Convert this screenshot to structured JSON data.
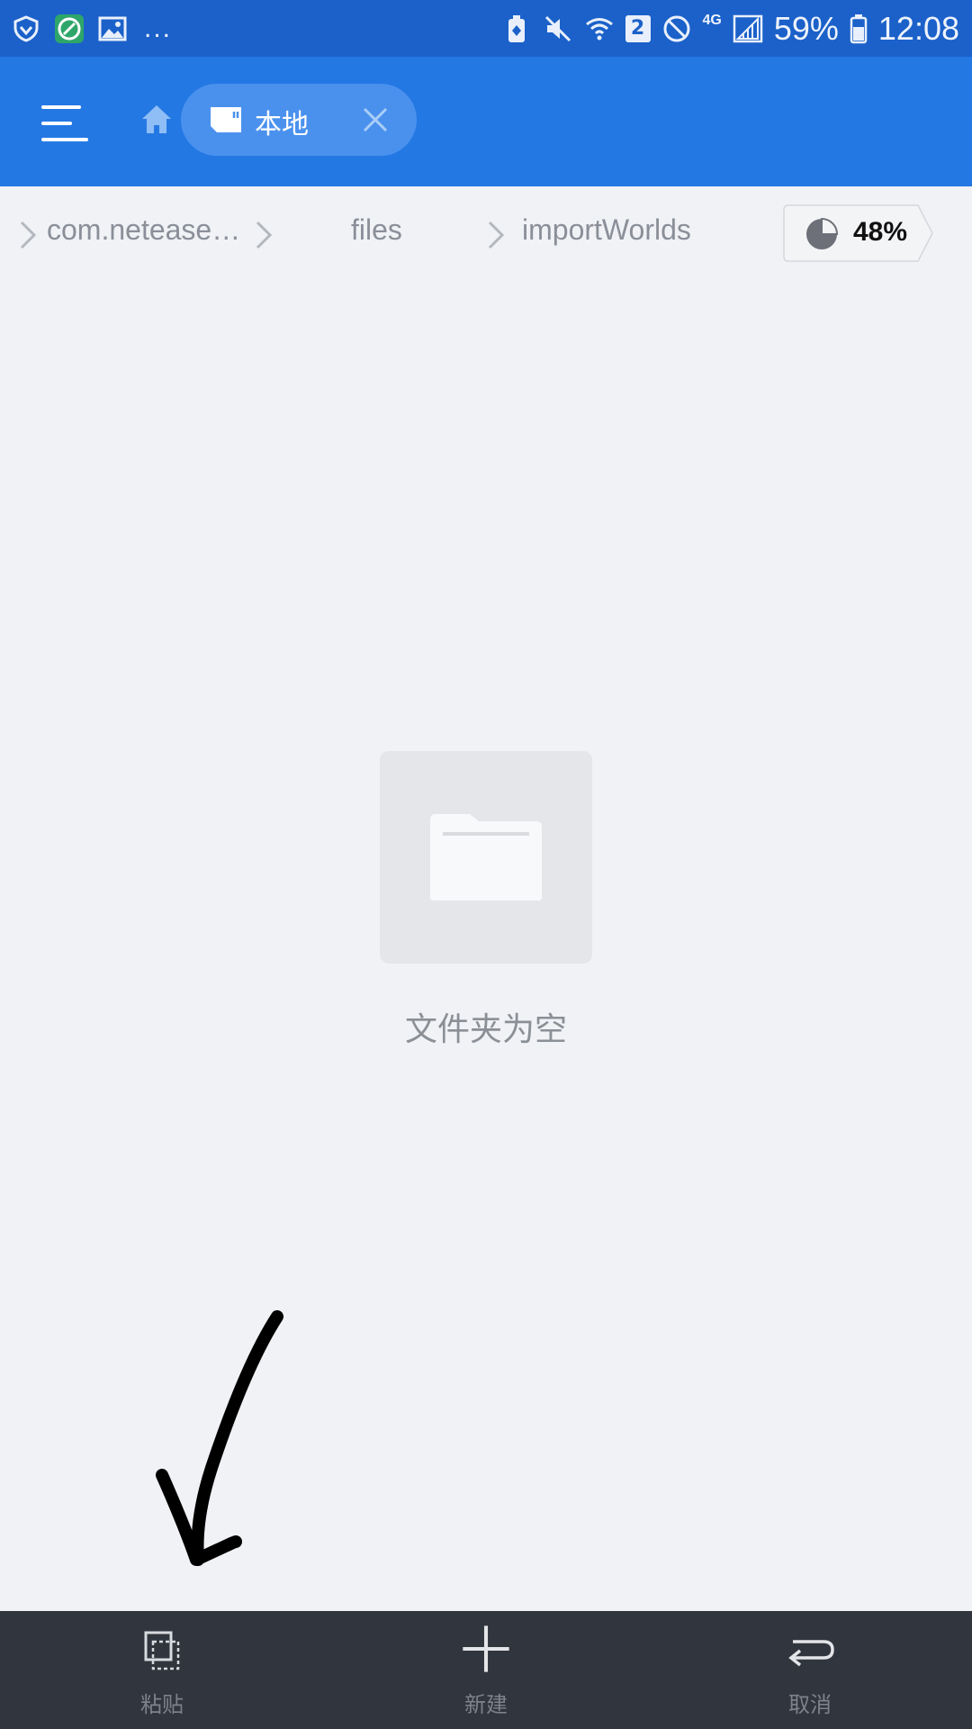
{
  "status_bar": {
    "battery_percent": "59%",
    "time": "12:08",
    "sim_slot": "2",
    "network_type": "4G",
    "overflow": "...",
    "icons": [
      "shield-icon",
      "app-icon",
      "image-icon",
      "battery-saver-icon",
      "mute-icon",
      "wifi-icon",
      "no-disturb-icon",
      "signal-icon",
      "battery-icon"
    ]
  },
  "app_bar": {
    "tab_label": "本地",
    "icons": [
      "menu-icon",
      "home-icon",
      "sd-card-icon",
      "close-icon"
    ]
  },
  "breadcrumb": {
    "items": [
      "com.netease…",
      "files",
      "importWorlds"
    ],
    "storage_usage": "48%"
  },
  "empty_state": {
    "message": "文件夹为空",
    "icon": "folder-icon"
  },
  "toolbar": {
    "paste_label": "粘贴",
    "new_label": "新建",
    "cancel_label": "取消",
    "icons": [
      "paste-icon",
      "plus-icon",
      "undo-icon"
    ]
  },
  "colors": {
    "status_bar": "#1b61c9",
    "app_bar": "#2478e4",
    "tab_chip": "#4a91ee",
    "background": "#f0f2f5",
    "toolbar": "#31353d"
  }
}
